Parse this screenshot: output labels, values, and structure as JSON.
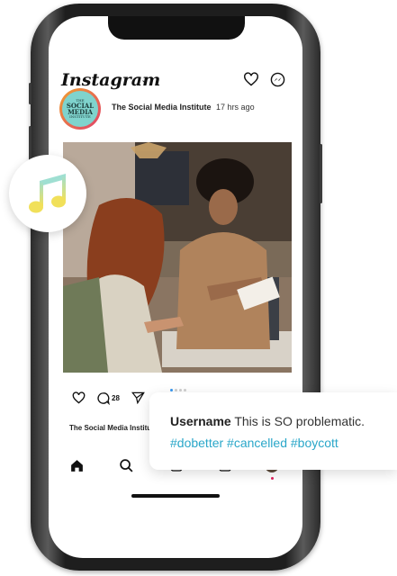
{
  "app": {
    "logo_text": "Instagram",
    "chevron_icon": "chevron-down-icon"
  },
  "header_icons": [
    "heart-outline-icon",
    "messenger-icon"
  ],
  "post": {
    "author": "The Social Media Institute",
    "time": "17 hrs ago",
    "avatar": {
      "line1": "THE",
      "line2": "SOCIAL MEDIA",
      "line3": "INSTITUTE"
    },
    "comment_count": "28",
    "caption_author": "The Social Media Institute",
    "carousel_total": 4,
    "carousel_active": 1
  },
  "bottom_nav": [
    "home-icon",
    "search-icon",
    "reels-icon",
    "shop-icon",
    "profile-avatar"
  ],
  "overlay_comment": {
    "username": "Username",
    "text": "This is SO problematic.",
    "hashtags": "#dobetter #cancelled #boycott"
  },
  "colors": {
    "hashtag": "#2aa7c9",
    "carousel_active": "#3897f0",
    "notification_dot": "#e0245e"
  }
}
